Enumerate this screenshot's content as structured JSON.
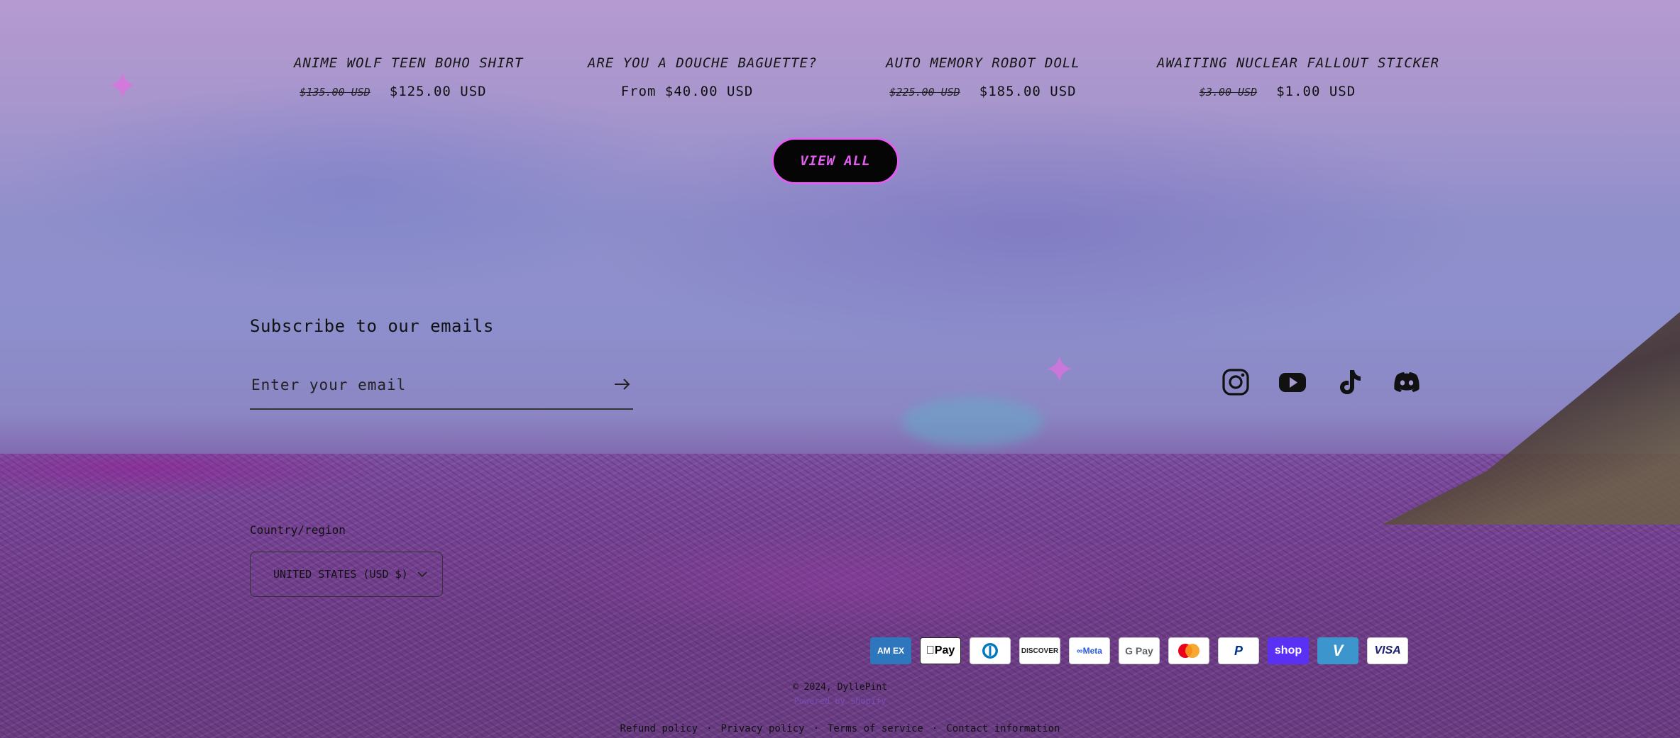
{
  "products": [
    {
      "title": "ANIME WOLF TEEN BOHO SHIRT",
      "price_old": "$135.00 USD",
      "price_new": "$125.00 USD"
    },
    {
      "title": "ARE YOU A DOUCHE BAGUETTE?",
      "price_old": "",
      "price_new": "From $40.00 USD"
    },
    {
      "title": "AUTO MEMORY ROBOT DOLL",
      "price_old": "$225.00 USD",
      "price_new": "$185.00 USD"
    },
    {
      "title": "AWAITING NUCLEAR FALLOUT STICKER",
      "price_old": "$3.00 USD",
      "price_new": "$1.00 USD"
    }
  ],
  "view_all_label": "VIEW ALL",
  "subscribe": {
    "title": "Subscribe to our emails",
    "placeholder": "Enter your email"
  },
  "social": [
    "instagram-icon",
    "youtube-icon",
    "tiktok-icon",
    "discord-icon"
  ],
  "country": {
    "label": "Country/region",
    "value": "UNITED STATES (USD $)"
  },
  "payments": [
    {
      "name": "American Express",
      "label": "AM EX",
      "color": "#2e77bc"
    },
    {
      "name": "Apple Pay",
      "label": "Pay",
      "color": "#000000"
    },
    {
      "name": "Diners Club",
      "label": "D",
      "color": "#0079be"
    },
    {
      "name": "Discover",
      "label": "DISCOVER",
      "color": "#f38b00"
    },
    {
      "name": "Meta Pay",
      "label": "∞Meta",
      "color": "#2a5ad8"
    },
    {
      "name": "Google Pay",
      "label": "G Pay",
      "color": "#5f6368"
    },
    {
      "name": "Mastercard",
      "label": "",
      "color": "#eb001b"
    },
    {
      "name": "PayPal",
      "label": "P",
      "color": "#003087"
    },
    {
      "name": "Shop Pay",
      "label": "shop",
      "color": "#5a31f4"
    },
    {
      "name": "Venmo",
      "label": "V",
      "color": "#3d95ce"
    },
    {
      "name": "Visa",
      "label": "VISA",
      "color": "#1a1f71"
    }
  ],
  "footer": {
    "copyright": "© 2024, DyllePint",
    "powered_by": "Powered by Shopify",
    "policies": [
      "Refund policy",
      "Privacy policy",
      "Terms of service",
      "Contact information"
    ]
  }
}
